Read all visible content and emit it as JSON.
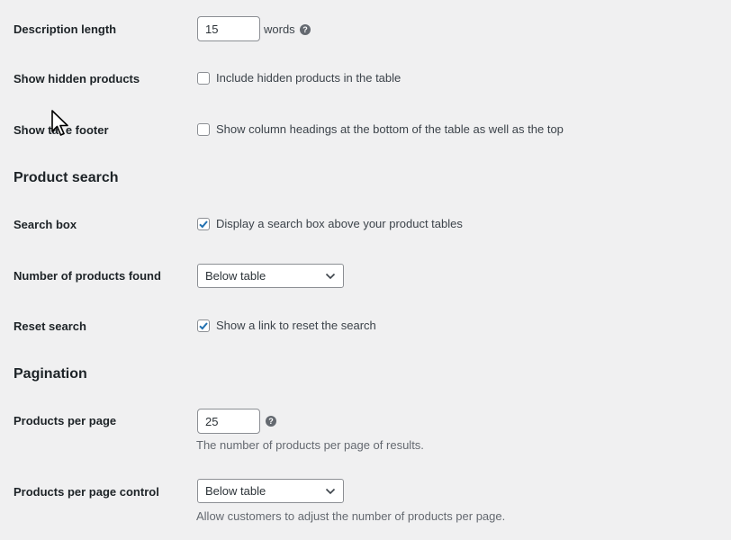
{
  "general": {
    "description_length": {
      "label": "Description length",
      "value": "15",
      "suffix": "words",
      "help": "?"
    },
    "show_hidden": {
      "label": "Show hidden products",
      "checkbox_label": "Include hidden products in the table",
      "checked": false
    },
    "show_footer": {
      "label_prefix": "Show ta",
      "label_suffix": "e footer",
      "checkbox_label": "Show column headings at the bottom of the table as well as the top",
      "checked": false
    }
  },
  "product_search": {
    "heading": "Product search",
    "search_box": {
      "label": "Search box",
      "checkbox_label": "Display a search box above your product tables",
      "checked": true
    },
    "products_found": {
      "label": "Number of products found",
      "selected": "Below table"
    },
    "reset_search": {
      "label": "Reset search",
      "checkbox_label": "Show a link to reset the search",
      "checked": true
    }
  },
  "pagination": {
    "heading": "Pagination",
    "per_page": {
      "label": "Products per page",
      "value": "25",
      "help": "?",
      "description": "The number of products per page of results."
    },
    "per_page_control": {
      "label": "Products per page control",
      "selected": "Below table",
      "description": "Allow customers to adjust the number of products per page."
    }
  },
  "colors": {
    "background": "#f0f0f1",
    "checkbox_check": "#2271b1",
    "text": "#1d2327",
    "muted": "#646970"
  },
  "icons": {
    "help": "help-icon",
    "checkmark": "checkmark-icon",
    "chevron": "chevron-down-icon",
    "cursor": "mouse-pointer-icon"
  }
}
